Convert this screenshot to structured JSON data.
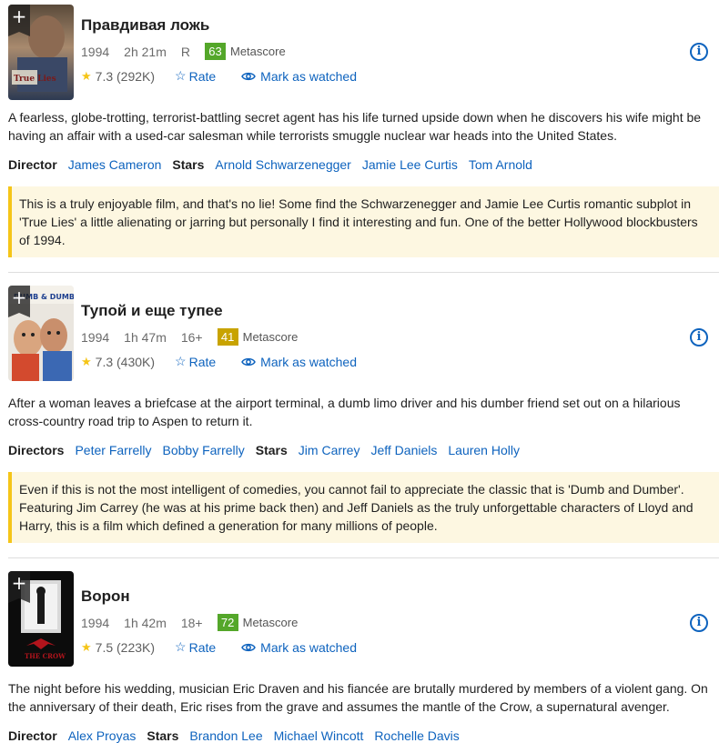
{
  "ui": {
    "add_symbol": "+",
    "metascore_label": "Metascore",
    "rate_label": "Rate",
    "watch_label": "Mark as watched",
    "info_symbol": "i",
    "rate_icon": "☆",
    "star_icon": "★",
    "icons": [
      "plus-icon",
      "star-icon",
      "rate-star-icon",
      "eye-icon",
      "info-icon"
    ]
  },
  "movies": [
    {
      "title": "Правдивая ложь",
      "year": "1994",
      "runtime": "2h 21m",
      "certificate": "R",
      "metascore": "63",
      "metascore_color": "#54a72a",
      "rating": "7.3 (292K)",
      "plot": "A fearless, globe-trotting, terrorist-battling secret agent has his life turned upside down when he discovers his wife might be having an affair with a used-car salesman while terrorists smuggle nuclear war heads into the United States.",
      "director_label": "Director",
      "directors": [
        "James Cameron"
      ],
      "stars_label": "Stars",
      "stars": [
        "Arnold Schwarzenegger",
        "Jamie Lee Curtis",
        "Tom Arnold"
      ],
      "review": "This is a truly enjoyable film, and that's no lie! Some find the Schwarzenegger and Jamie Lee Curtis romantic subplot in 'True Lies' a little alienating or jarring but personally I find it interesting and fun. One of the better Hollywood blockbusters of 1994.",
      "poster_text": "True Lies"
    },
    {
      "title": "Тупой и еще тупее",
      "year": "1994",
      "runtime": "1h 47m",
      "certificate": "16+",
      "metascore": "41",
      "metascore_color": "#c8a300",
      "rating": "7.3 (430K)",
      "plot": "After a woman leaves a briefcase at the airport terminal, a dumb limo driver and his dumber friend set out on a hilarious cross-country road trip to Aspen to return it.",
      "director_label": "Directors",
      "directors": [
        "Peter Farrelly",
        "Bobby Farrelly"
      ],
      "stars_label": "Stars",
      "stars": [
        "Jim Carrey",
        "Jeff Daniels",
        "Lauren Holly"
      ],
      "review": "Even if this is not the most intelligent of comedies, you cannot fail to appreciate the classic that is 'Dumb and Dumber'. Featuring Jim Carrey (he was at his prime back then) and Jeff Daniels as the truly unforgettable characters of Lloyd and Harry, this is a film which defined a generation for many millions of people.",
      "poster_text": "DUMB & DUMBER"
    },
    {
      "title": "Ворон",
      "year": "1994",
      "runtime": "1h 42m",
      "certificate": "18+",
      "metascore": "72",
      "metascore_color": "#54a72a",
      "rating": "7.5 (223K)",
      "plot": "The night before his wedding, musician Eric Draven and his fiancée are brutally murdered by members of a violent gang. On the anniversary of their death, Eric rises from the grave and assumes the mantle of the Crow, a supernatural avenger.",
      "director_label": "Director",
      "directors": [
        "Alex Proyas"
      ],
      "stars_label": "Stars",
      "stars": [
        "Brandon Lee",
        "Michael Wincott",
        "Rochelle Davis"
      ],
      "review": "",
      "poster_text": "THE CROW"
    }
  ]
}
